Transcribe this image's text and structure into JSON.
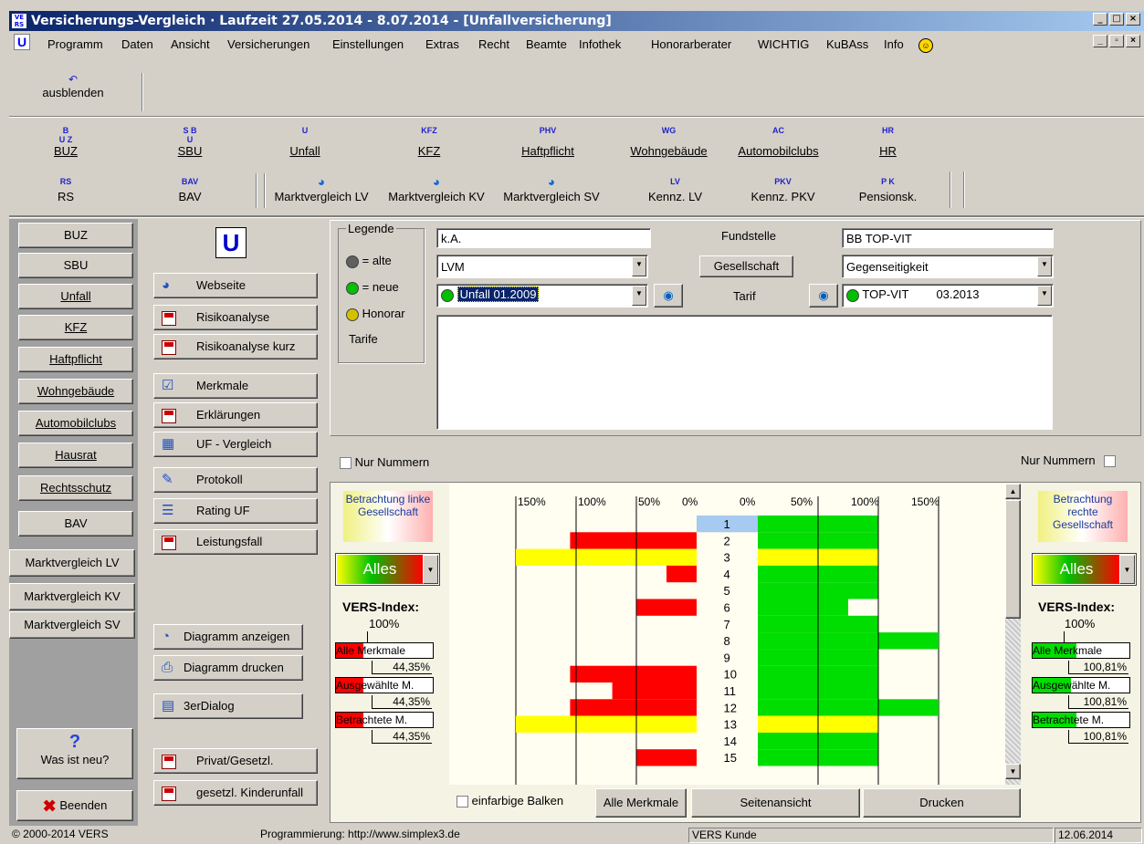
{
  "window": {
    "title": "Versicherungs-Vergleich · Laufzeit 27.05.2014 - 8.07.2014 - [Unfallversicherung]"
  },
  "menu": [
    "Programm",
    "Daten",
    "Ansicht",
    "Versicherungen",
    "Einstellungen",
    "Extras",
    "Recht",
    "Beamte",
    "Infothek",
    "Honorarberater",
    "WICHTIG",
    "KuBAss",
    "Info"
  ],
  "toolbar": {
    "hide_label": "ausblenden"
  },
  "tabs_row1": [
    {
      "small": "B\nU Z",
      "label": "BUZ"
    },
    {
      "small": "S B\nU",
      "label": "SBU"
    },
    {
      "small": "U",
      "label": "Unfall"
    },
    {
      "small": "KFZ",
      "label": "KFZ"
    },
    {
      "small": "PHV",
      "label": "Haftpflicht"
    },
    {
      "small": "WG",
      "label": "Wohngebäude"
    },
    {
      "small": "AC",
      "label": "Automobilclubs"
    },
    {
      "small": "HR",
      "label": "HR"
    }
  ],
  "tabs_row2": [
    {
      "small": "RS",
      "label": "RS"
    },
    {
      "small": "BAV",
      "label": "BAV"
    },
    {
      "small": "",
      "label": "Marktvergleich LV"
    },
    {
      "small": "",
      "label": "Marktvergleich KV"
    },
    {
      "small": "",
      "label": "Marktvergleich SV"
    },
    {
      "small": "LV",
      "label": "Kennz. LV"
    },
    {
      "small": "PKV",
      "label": "Kennz. PKV"
    },
    {
      "small": "P K",
      "label": "Pensionsk."
    }
  ],
  "nav": [
    "BUZ",
    "SBU",
    "Unfall",
    "KFZ",
    "Haftpflicht",
    "Wohngebäude",
    "Automobilclubs",
    "Hausrat",
    "Rechtsschutz",
    "BAV",
    "Marktvergleich LV",
    "Marktvergleich KV",
    "Marktvergleich SV"
  ],
  "nav_bottom": {
    "whatsnew": "Was ist neu?",
    "exit": "Beenden",
    "u_logo": "U"
  },
  "actions": [
    "Webseite",
    "Risikoanalyse",
    "Risikoanalyse kurz",
    "Merkmale",
    "Erklärungen",
    "UF - Vergleich",
    "Protokoll",
    "Rating UF",
    "Leistungsfall",
    "Diagramm anzeigen",
    "Diagramm drucken",
    "3erDialog",
    "Privat/Gesetzl.",
    "gesetzl. Kinderunfall"
  ],
  "legend": {
    "title": "Legende",
    "old": "= alte",
    "new": "= neue",
    "honorar": "Honorar",
    "tarife": "Tarife"
  },
  "form": {
    "left_value": "k.A.",
    "company_left": "LVM",
    "tariff_left": "Unfall 01.2009",
    "fundstelle_label": "Fundstelle",
    "gesellschaft_button": "Gesellschaft",
    "tarif_label": "Tarif",
    "right_value": "BB TOP-VIT",
    "company_right": "Gegenseitigkeit",
    "tariff_right": "TOP-VIT",
    "tariff_right_date": "03.2013"
  },
  "compare": {
    "nur_nummern": "Nur Nummern",
    "left_heading": "Betrachtung linke Gesellschaft",
    "right_heading": "Betrachtung rechte Gesellschaft",
    "filter": "Alles",
    "index_title": "VERS-Index:",
    "index_base": "100%",
    "left_rows": [
      {
        "label": "Alle Merkmale",
        "value": "44,35%"
      },
      {
        "label": "Ausgewählte M.",
        "value": "44,35%"
      },
      {
        "label": "Betrachtete M.",
        "value": "44,35%"
      }
    ],
    "right_rows": [
      {
        "label": "Alle Merkmale",
        "value": "100,81%"
      },
      {
        "label": "Ausgewählte M.",
        "value": "100,81%"
      },
      {
        "label": "Betrachtete M.",
        "value": "100,81%"
      }
    ],
    "left_ticks": [
      "150%",
      "100%",
      "50%",
      "0%"
    ],
    "right_ticks": [
      "0%",
      "50%",
      "100%",
      "150%"
    ],
    "bottom": {
      "mono": "einfarbige Balken",
      "all": "Alle Merkmale",
      "page": "Seitenansicht",
      "print": "Drucken"
    }
  },
  "chart_data": {
    "type": "bar",
    "categories": [
      "1",
      "2",
      "3",
      "4",
      "5",
      "6",
      "7",
      "8",
      "9",
      "10",
      "11",
      "12",
      "13",
      "14",
      "15"
    ],
    "series": [
      {
        "side": "left",
        "values": [
          0,
          105,
          150,
          25,
          0,
          50,
          0,
          0,
          0,
          105,
          70,
          105,
          150,
          0,
          50
        ],
        "colors": [
          "none",
          "#ff0000",
          "#ffff00",
          "#ff0000",
          "none",
          "#ff0000",
          "none",
          "none",
          "none",
          "#ff0000",
          "#ff0000",
          "#ff0000",
          "#ffff00",
          "none",
          "#ff0000"
        ]
      },
      {
        "side": "right",
        "values": [
          100,
          100,
          100,
          100,
          100,
          75,
          100,
          150,
          100,
          100,
          100,
          150,
          100,
          100,
          100
        ],
        "colors": [
          "#00dd00",
          "#00dd00",
          "#ffff00",
          "#00dd00",
          "#00dd00",
          "#00dd00",
          "#00dd00",
          "#00dd00",
          "#00dd00",
          "#00dd00",
          "#00dd00",
          "#00dd00",
          "#ffff00",
          "#00dd00",
          "#00dd00"
        ]
      }
    ],
    "xlim": [
      0,
      150
    ],
    "highlight": "1"
  },
  "status": {
    "copyright": "© 2000-2014 VERS",
    "programming": "Programmierung: http://www.simplex3.de",
    "user": "VERS Kunde",
    "date": "12.06.2014"
  }
}
